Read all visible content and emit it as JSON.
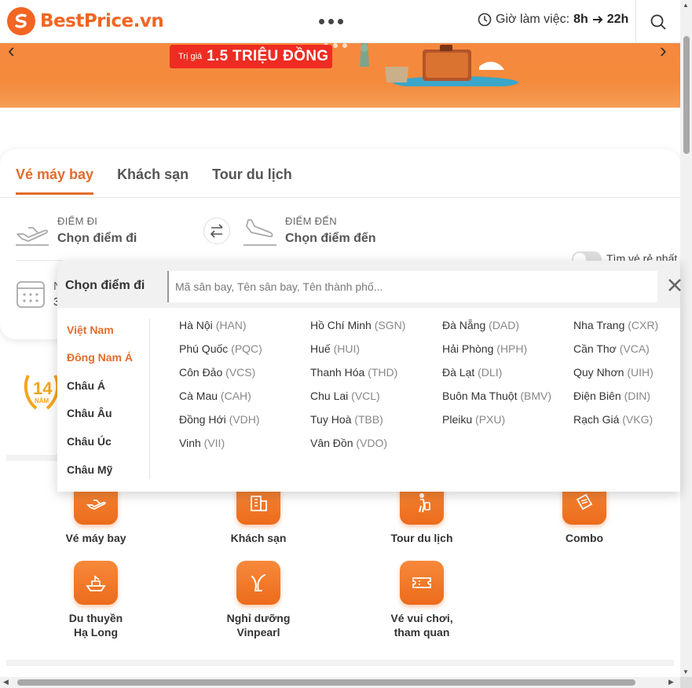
{
  "header": {
    "logo_text": "BestPrice.vn",
    "hours_label": "Giờ làm việc:",
    "hours_from": "8h",
    "hours_to": "22h"
  },
  "banner": {
    "pill_small": "Trị giá",
    "pill_big": "1.5 TRIỆU ĐỒNG"
  },
  "tabs": [
    {
      "label": "Vé máy bay",
      "active": true
    },
    {
      "label": "Khách sạn",
      "active": false
    },
    {
      "label": "Tour du lịch",
      "active": false
    }
  ],
  "search": {
    "from_label": "ĐIỂM ĐI",
    "from_value": "Chọn điểm đi",
    "to_label": "ĐIỂM ĐẾN",
    "to_value": "Chọn điểm đến",
    "cheapest_toggle": "Tìm vé rẻ nhất",
    "date_partial_1": "N",
    "date_partial_2": "3"
  },
  "badge": {
    "number": "14",
    "unit": "NĂM"
  },
  "dropdown": {
    "title": "Chọn điểm đi",
    "placeholder": "Mã sân bay, Tên sân bay, Tên thành phố...",
    "regions": [
      {
        "label": "Việt Nam",
        "active": true
      },
      {
        "label": "Đông Nam Á",
        "active": true
      },
      {
        "label": "Châu Á",
        "active": false
      },
      {
        "label": "Châu Âu",
        "active": false
      },
      {
        "label": "Châu Úc",
        "active": false
      },
      {
        "label": "Châu Mỹ",
        "active": false
      }
    ],
    "cities": [
      {
        "name": "Hà Nội",
        "code": "(HAN)"
      },
      {
        "name": "Hồ Chí Minh",
        "code": "(SGN)"
      },
      {
        "name": "Đà Nẵng",
        "code": "(DAD)"
      },
      {
        "name": "Nha Trang",
        "code": "(CXR)"
      },
      {
        "name": "Phú Quốc",
        "code": "(PQC)"
      },
      {
        "name": "Huế",
        "code": "(HUI)"
      },
      {
        "name": "Hải Phòng",
        "code": "(HPH)"
      },
      {
        "name": "Cần Thơ",
        "code": "(VCA)"
      },
      {
        "name": "Côn Đảo",
        "code": "(VCS)"
      },
      {
        "name": "Thanh Hóa",
        "code": "(THD)"
      },
      {
        "name": "Đà Lạt",
        "code": "(DLI)"
      },
      {
        "name": "Quy Nhơn",
        "code": "(UIH)"
      },
      {
        "name": "Cà Mau",
        "code": "(CAH)"
      },
      {
        "name": "Chu Lai",
        "code": "(VCL)"
      },
      {
        "name": "Buôn Ma Thuột",
        "code": "(BMV)"
      },
      {
        "name": "Điện Biên",
        "code": "(DIN)"
      },
      {
        "name": "Đồng Hới",
        "code": "(VDH)"
      },
      {
        "name": "Tuy Hoà",
        "code": "(TBB)"
      },
      {
        "name": "Pleiku",
        "code": "(PXU)"
      },
      {
        "name": "Rạch Giá",
        "code": "(VKG)"
      },
      {
        "name": "Vinh",
        "code": "(VII)"
      },
      {
        "name": "Vân Đồn",
        "code": "(VDO)"
      }
    ]
  },
  "services": [
    {
      "line1": "Vé máy bay",
      "line2": "",
      "icon": "plane-icon"
    },
    {
      "line1": "Khách sạn",
      "line2": "",
      "icon": "hotel-icon"
    },
    {
      "line1": "Tour du lịch",
      "line2": "",
      "icon": "traveler-icon"
    },
    {
      "line1": "Combo",
      "line2": "",
      "icon": "combo-ticket-icon"
    },
    {
      "line1": "Du thuyền",
      "line2": "Hạ Long",
      "icon": "cruise-icon"
    },
    {
      "line1": "Nghỉ dưỡng",
      "line2": "Vinpearl",
      "icon": "vinpearl-icon"
    },
    {
      "line1": "Vé vui chơi,",
      "line2": "tham quan",
      "icon": "ticket-icon"
    }
  ],
  "colors": {
    "brand": "#f26522",
    "accent": "#e36c2b",
    "promo_red": "#ee2c22"
  }
}
